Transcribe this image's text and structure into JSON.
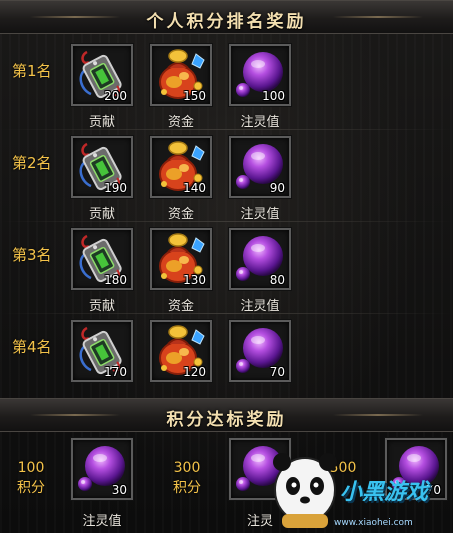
{
  "panel": {
    "rank_title": "个人积分排名奖励",
    "milestone_title": "积分达标奖励"
  },
  "rank_rewards": [
    {
      "rank": "第1名",
      "items": [
        {
          "icon": "contribution-token-icon",
          "label": "贡献",
          "count": "200"
        },
        {
          "icon": "gold-money-bag-icon",
          "label": "资金",
          "count": "150"
        },
        {
          "icon": "purple-spirit-orb-icon",
          "label": "注灵值",
          "count": "100"
        }
      ]
    },
    {
      "rank": "第2名",
      "items": [
        {
          "icon": "contribution-token-icon",
          "label": "贡献",
          "count": "190"
        },
        {
          "icon": "gold-money-bag-icon",
          "label": "资金",
          "count": "140"
        },
        {
          "icon": "purple-spirit-orb-icon",
          "label": "注灵值",
          "count": "90"
        }
      ]
    },
    {
      "rank": "第3名",
      "items": [
        {
          "icon": "contribution-token-icon",
          "label": "贡献",
          "count": "180"
        },
        {
          "icon": "gold-money-bag-icon",
          "label": "资金",
          "count": "130"
        },
        {
          "icon": "purple-spirit-orb-icon",
          "label": "注灵值",
          "count": "80"
        }
      ]
    },
    {
      "rank": "第4名",
      "items": [
        {
          "icon": "contribution-token-icon",
          "label": "",
          "count": "170"
        },
        {
          "icon": "gold-money-bag-icon",
          "label": "",
          "count": "120"
        },
        {
          "icon": "purple-spirit-orb-icon",
          "label": "",
          "count": "70"
        }
      ]
    }
  ],
  "milestone_rewards": [
    {
      "points": "100",
      "unit": "积分",
      "icon": "purple-spirit-orb-icon",
      "label": "注灵值",
      "count": "30"
    },
    {
      "points": "300",
      "unit": "积分",
      "icon": "purple-spirit-orb-icon",
      "label": "注灵",
      "count": ""
    },
    {
      "points": "500",
      "unit": "",
      "icon": "purple-spirit-orb-icon",
      "label": "",
      "count": "70"
    }
  ],
  "watermark": {
    "text": "小黑游戏",
    "url": "www.xiaohei.com"
  },
  "colors": {
    "gold_text": "#f4c34a",
    "title_text": "#f3dfb0",
    "slot_border": "#5b5b5b",
    "count_text": "#ffffff"
  }
}
